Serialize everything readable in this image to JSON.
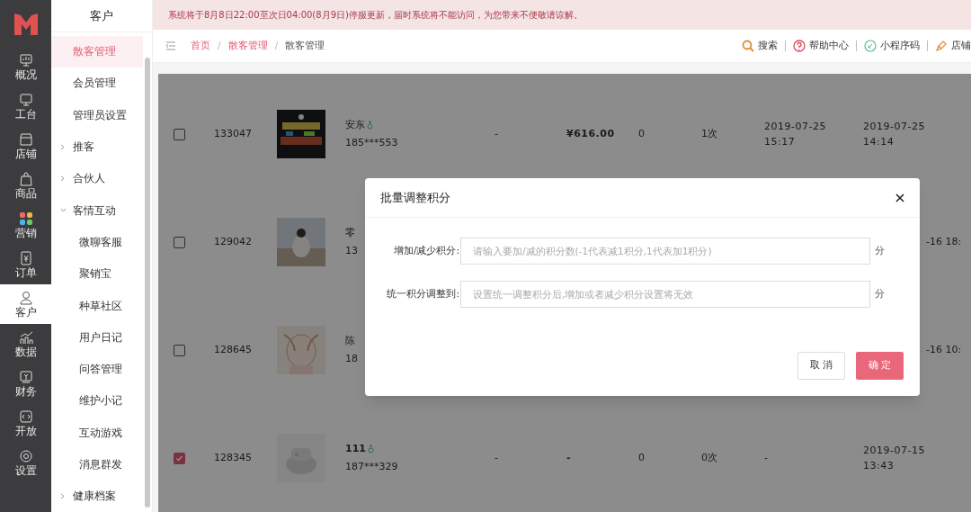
{
  "rail": {
    "items": [
      {
        "label": "概况",
        "selected": false
      },
      {
        "label": "工台",
        "selected": false
      },
      {
        "label": "店铺",
        "selected": false
      },
      {
        "label": "商品",
        "selected": false
      },
      {
        "label": "营销",
        "selected": false
      },
      {
        "label": "订单",
        "selected": false
      },
      {
        "label": "客户",
        "selected": true
      },
      {
        "label": "数据",
        "selected": false
      },
      {
        "label": "财务",
        "selected": false
      },
      {
        "label": "开放",
        "selected": false
      },
      {
        "label": "设置",
        "selected": false
      }
    ]
  },
  "submenu": {
    "title": "客户",
    "items": [
      {
        "label": "散客管理",
        "selected": true
      },
      {
        "label": "会员管理",
        "selected": false
      },
      {
        "label": "管理员设置",
        "selected": false
      },
      {
        "label": "推客",
        "selected": false,
        "expanded": false
      },
      {
        "label": "合伙人",
        "selected": false,
        "expanded": false
      },
      {
        "label": "客情互动",
        "selected": false,
        "expanded": true,
        "children": [
          {
            "label": "微聊客服",
            "selected": false
          },
          {
            "label": "聚销宝",
            "selected": false
          },
          {
            "label": "种草社区",
            "selected": false
          },
          {
            "label": "用户日记",
            "selected": false
          },
          {
            "label": "问答管理",
            "selected": false
          },
          {
            "label": "维护小记",
            "selected": false
          },
          {
            "label": "互动游戏",
            "selected": false
          },
          {
            "label": "消息群发",
            "selected": false
          }
        ]
      },
      {
        "label": "健康档案",
        "selected": false,
        "expanded": false
      }
    ]
  },
  "notice": "系统将于8月8日22:00至次日04:00(8月9日)停服更新，届时系统将不能访问，为您带来不便敬请谅解。",
  "breadcrumb": [
    "首页",
    "散客管理",
    "散客管理"
  ],
  "breadcrumb_separator": "/",
  "header_links": [
    "搜索",
    "帮助中心",
    "小程序码",
    "店铺"
  ],
  "table": {
    "rows": [
      {
        "kind": "full",
        "selected": false,
        "id": "133047",
        "name": "安东",
        "phone": "185***553",
        "col_5": "-",
        "amount": "¥616.00",
        "col_7": "0",
        "count": "1次",
        "date_1": "2019-07-25 15:17",
        "date_2": "2019-07-25 14:14"
      },
      {
        "kind": "covered",
        "selected": false,
        "id": "129042",
        "name": "零",
        "phone": "13",
        "date_2": "-16 18:"
      },
      {
        "kind": "covered",
        "selected": false,
        "id": "128645",
        "name": "陈",
        "phone": "18",
        "date_2": "-16 10:"
      },
      {
        "kind": "full",
        "selected": true,
        "id": "128345",
        "name": "111",
        "phone": "187***329",
        "col_5": "-",
        "amount": "-",
        "col_7": "0",
        "count": "0次",
        "date_1": "-",
        "date_2": "2019-07-15 13:43"
      }
    ]
  },
  "dialog": {
    "title": "批量调整积分",
    "fields": [
      {
        "label": "增加/减少积分:",
        "placeholder": "请输入要加/减的积分数(-1代表减1积分,1代表加1积分)",
        "unit": "分"
      },
      {
        "label": "统一积分调整到:",
        "placeholder": "设置统一调整积分后,增加或者减少积分设置将无效",
        "unit": "分"
      }
    ],
    "buttons": [
      "取 消",
      "确 定"
    ]
  }
}
